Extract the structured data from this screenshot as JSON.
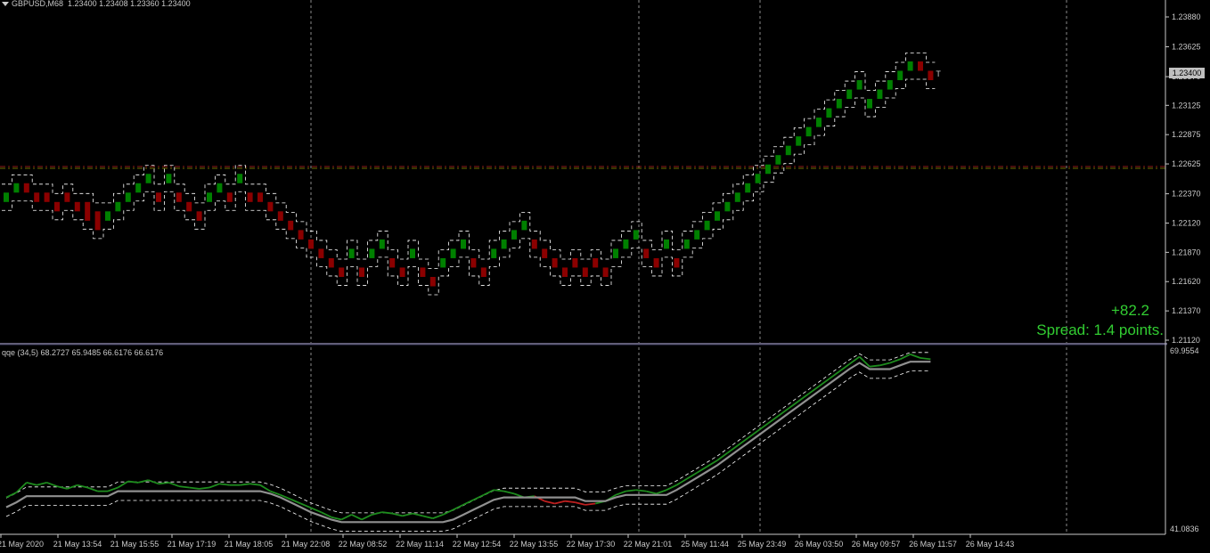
{
  "header": {
    "symbol": "GBPUSD,M68",
    "ohlc": "1.23400 1.23408 1.23360 1.23400"
  },
  "indicator_header": "qqe (34,5) 68.2727 65.9485 66.6176 66.6176",
  "overlay": {
    "profit": "+82.2",
    "spread": "Spread: 1.4 points."
  },
  "current_price": "1.23400",
  "colors": {
    "background": "#000000",
    "bull": "#008000",
    "bear": "#8b0000",
    "qqe_main": "#1e8c1e",
    "qqe_bear": "#c02020",
    "qqe_signal": "#909090",
    "band": "#ffffff",
    "level_line": "#8b1a1a",
    "grid": "#8a8a8a"
  },
  "chart_data": [
    {
      "type": "candlestick",
      "name": "GBPUSD,M68",
      "ylim": [
        1.2112,
        1.2388
      ],
      "y_ticks": [
        "1.23880",
        "1.23625",
        "1.23370",
        "1.23125",
        "1.22875",
        "1.22625",
        "1.22370",
        "1.22120",
        "1.21870",
        "1.21620",
        "1.21370",
        "1.21120"
      ],
      "horizontal_level": 1.226,
      "box_size": 0.0008,
      "candle_opens": [
        1.223,
        1.2238,
        1.2246,
        1.2238,
        1.2238,
        1.223,
        1.2238,
        1.223,
        1.223,
        1.2222,
        1.2214,
        1.2222,
        1.223,
        1.2238,
        1.2246,
        1.2238,
        1.2246,
        1.2238,
        1.223,
        1.2222,
        1.223,
        1.2238,
        1.2238,
        1.2246,
        1.2238,
        1.2238,
        1.223,
        1.2222,
        1.2214,
        1.2206,
        1.2198,
        1.219,
        1.2182,
        1.2174,
        1.2182,
        1.2174,
        1.2182,
        1.219,
        1.2182,
        1.2174,
        1.2182,
        1.2174,
        1.2166,
        1.2174,
        1.2182,
        1.219,
        1.2182,
        1.2174,
        1.2182,
        1.219,
        1.2198,
        1.2206,
        1.2198,
        1.219,
        1.2182,
        1.2174,
        1.2182,
        1.2174,
        1.2182,
        1.2174,
        1.2182,
        1.219,
        1.2198,
        1.219,
        1.2182,
        1.219,
        1.2182,
        1.219,
        1.2198,
        1.2206,
        1.2214,
        1.2222,
        1.223,
        1.2238,
        1.2246,
        1.2254,
        1.2262,
        1.227,
        1.2278,
        1.2286,
        1.2294,
        1.2302,
        1.231,
        1.2318,
        1.2326,
        1.231,
        1.2318,
        1.2326,
        1.2334,
        1.2342,
        1.235,
        1.2342
      ],
      "candle_closes": [
        1.2238,
        1.2246,
        1.2238,
        1.223,
        1.223,
        1.2222,
        1.223,
        1.2222,
        1.2214,
        1.2206,
        1.2222,
        1.223,
        1.2238,
        1.2246,
        1.2254,
        1.223,
        1.2254,
        1.223,
        1.2222,
        1.2214,
        1.2238,
        1.2246,
        1.223,
        1.2254,
        1.223,
        1.223,
        1.2222,
        1.2214,
        1.2206,
        1.2198,
        1.219,
        1.2182,
        1.2174,
        1.2166,
        1.219,
        1.2166,
        1.219,
        1.2198,
        1.2174,
        1.2166,
        1.219,
        1.2166,
        1.2158,
        1.2182,
        1.219,
        1.2198,
        1.2174,
        1.2166,
        1.219,
        1.2198,
        1.2206,
        1.2214,
        1.219,
        1.2182,
        1.2174,
        1.2166,
        1.2174,
        1.2166,
        1.2174,
        1.2166,
        1.219,
        1.2198,
        1.2206,
        1.2182,
        1.2174,
        1.2198,
        1.2174,
        1.2198,
        1.2206,
        1.2214,
        1.2222,
        1.223,
        1.2238,
        1.2246,
        1.2254,
        1.2262,
        1.227,
        1.2278,
        1.2286,
        1.2294,
        1.2302,
        1.231,
        1.2318,
        1.2326,
        1.2334,
        1.2318,
        1.2326,
        1.2334,
        1.2342,
        1.235,
        1.2342,
        1.2334
      ]
    },
    {
      "type": "line",
      "name": "qqe (34,5)",
      "ylim": [
        41.0836,
        69.9554
      ],
      "y_ticks": [
        "69.9554",
        "41.0836"
      ],
      "x_tick_labels": [
        "21 May 2020",
        "21 May 13:54",
        "21 May 15:55",
        "21 May 17:19",
        "21 May 18:05",
        "21 May 22:08",
        "22 May 08:52",
        "22 May 11:14",
        "22 May 12:54",
        "22 May 13:55",
        "22 May 17:30",
        "22 May 21:01",
        "25 May 11:44",
        "25 May 23:49",
        "26 May 03:50",
        "26 May 09:57",
        "26 May 11:57",
        "26 May 14:43"
      ],
      "series": [
        {
          "values": [
            46.2,
            47.0,
            48.6,
            48.2,
            48.6,
            48.0,
            47.6,
            48.2,
            47.8,
            47.2,
            47.2,
            47.8,
            48.8,
            48.6,
            49.0,
            48.4,
            48.6,
            48.0,
            47.8,
            47.6,
            47.8,
            48.4,
            48.2,
            48.2,
            48.4,
            48.2,
            47.2,
            46.6,
            45.9,
            45.2,
            44.5,
            43.8,
            43.0,
            42.6,
            43.4,
            42.6,
            43.4,
            43.8,
            43.6,
            43.2,
            43.6,
            43.2,
            42.8,
            43.4,
            44.2,
            45.0,
            45.8,
            46.6,
            47.4,
            47.2,
            46.8,
            46.2,
            46.4,
            45.6,
            45.2,
            45.6,
            45.4,
            45.0,
            45.2,
            45.6,
            46.6,
            47.2,
            47.4,
            47.2,
            46.8,
            47.4,
            48.2,
            49.2,
            50.2,
            51.2,
            52.2,
            53.4,
            54.6,
            55.8,
            57.0,
            58.2,
            59.4,
            60.6,
            61.8,
            63.0,
            64.2,
            65.4,
            66.6,
            67.8,
            69.0,
            67.4,
            67.6,
            68.0,
            68.6,
            69.4,
            68.8,
            68.6
          ]
        },
        {
          "values": [
            44.6,
            45.4,
            46.4,
            46.4,
            46.4,
            46.4,
            46.4,
            46.4,
            46.4,
            46.4,
            46.4,
            47.2,
            47.2,
            47.2,
            47.2,
            47.2,
            47.2,
            47.2,
            47.2,
            47.2,
            47.2,
            47.2,
            47.2,
            47.2,
            47.2,
            47.2,
            46.8,
            46.2,
            45.4,
            44.6,
            43.8,
            43.2,
            42.6,
            42.2,
            42.2,
            42.2,
            42.2,
            42.2,
            42.2,
            42.2,
            42.2,
            42.2,
            42.2,
            42.2,
            42.6,
            43.4,
            44.2,
            45.0,
            45.8,
            46.2,
            46.2,
            46.2,
            46.2,
            46.2,
            46.2,
            46.2,
            46.2,
            45.6,
            45.6,
            45.6,
            46.2,
            46.6,
            46.6,
            46.6,
            46.6,
            46.6,
            47.4,
            48.4,
            49.4,
            50.4,
            51.4,
            52.6,
            53.8,
            55.0,
            56.2,
            57.4,
            58.6,
            59.8,
            61.0,
            62.2,
            63.4,
            64.6,
            65.8,
            67.0,
            68.0,
            67.0,
            67.0,
            67.0,
            67.6,
            68.2,
            68.2,
            68.2
          ]
        }
      ]
    }
  ]
}
